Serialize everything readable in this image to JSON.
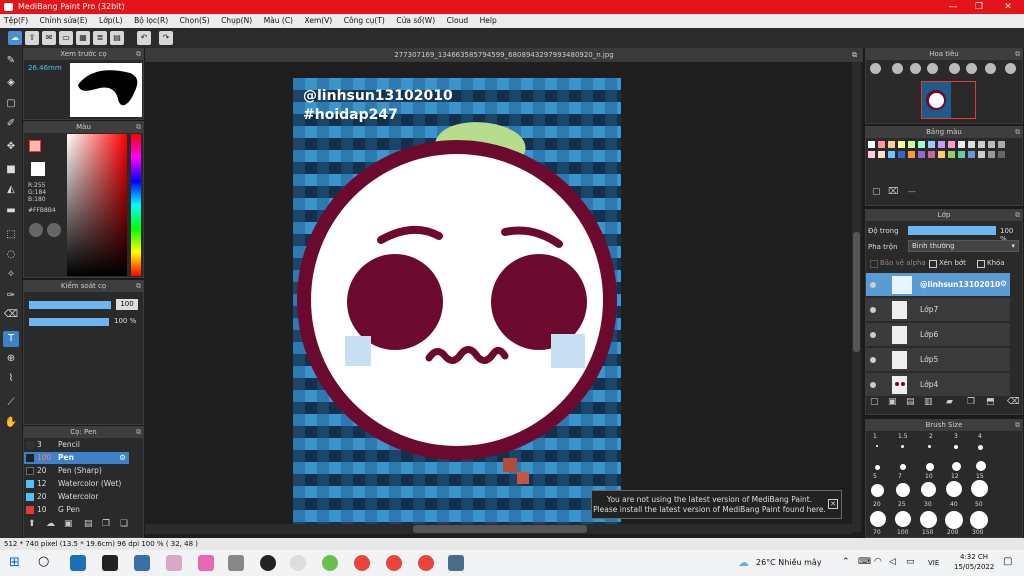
{
  "window": {
    "title": "MediBang Paint Pro (32bit)",
    "controls": [
      "—",
      "❐",
      "✕"
    ]
  },
  "menu": [
    "Tệp(F)",
    "Chỉnh sửa(E)",
    "Lớp(L)",
    "Bộ lọc(R)",
    "Chọn(S)",
    "Chụp(N)",
    "Màu (C)",
    "Xem(V)",
    "Công cụ(T)",
    "Cửa sổ(W)",
    "Cloud",
    "Help"
  ],
  "document": {
    "filename": "277307169_1346635857945​99_6808943297993480920_n.jpg"
  },
  "preview": {
    "title": "Xem trước cọ",
    "size": "26.46mm"
  },
  "color_panel": {
    "title": "Màu",
    "r": "R:255",
    "g": "G:184",
    "b": "B:180",
    "hex": "#FFB8B4",
    "primary": "#ffb8b4",
    "secondary": "#ffffff"
  },
  "brush_control": {
    "title": "Kiểm soát cọ",
    "size": "100",
    "opacity": "100 %"
  },
  "brush_list": {
    "title": "Cọ: Pen",
    "items": [
      {
        "size": "3",
        "name": "Pencil",
        "color": "#333333"
      },
      {
        "size": "100",
        "name": "Pen",
        "color": "#222222"
      },
      {
        "size": "20",
        "name": "Pen (Sharp)",
        "color": "#222222"
      },
      {
        "size": "12",
        "name": "Watercolor (Wet)",
        "color": "#4fc3f7"
      },
      {
        "size": "20",
        "name": "Watercolor",
        "color": "#4fc3f7"
      },
      {
        "size": "10",
        "name": "G Pen",
        "color": "#e53935"
      }
    ]
  },
  "canvas_text": {
    "line1": "@linhsun13102010",
    "line2": "#hoidap247"
  },
  "notice": {
    "line1": "You are not using the latest version of MediBang Paint.",
    "line2": "Please install the latest version of MediBang Paint found here."
  },
  "navigator": {
    "title": "Hoa tiêu"
  },
  "palette": {
    "title": "Bảng màu",
    "footer": "---"
  },
  "layer_panel": {
    "title": "Lớp",
    "opacity_label": "Độ trong",
    "opacity_value": "100 %",
    "blend_label": "Pha trộn",
    "blend_value": "Bình thường",
    "protect_alpha": "Bảo vệ alpha",
    "clipping": "Xén bớt",
    "lock": "Khóa",
    "layers": [
      "@linhsun13102010",
      "Lớp7",
      "Lớp6",
      "Lớp5",
      "Lớp4"
    ]
  },
  "brush_size": {
    "title": "Brush Size",
    "labels": [
      "1",
      "1.5",
      "2",
      "3",
      "4",
      "5",
      "7",
      "10",
      "12",
      "15",
      "20",
      "25",
      "30",
      "40",
      "50",
      "70",
      "100",
      "150",
      "200",
      "300"
    ]
  },
  "status": {
    "text": "512 * 740 pixel   (13.5 * 19.6cm)  96 dpi  100 %  ( 32, 48 )"
  },
  "taskbar": {
    "weather": "26°C  Nhiều mây",
    "lang": "VIE",
    "time": "4:32 CH",
    "date": "15/05/2022"
  },
  "colors": {
    "title_red": "#e4141b",
    "plum": "#6b0a2e",
    "blue_sel": "#3b83c6",
    "leaf": "#b6dd8c"
  }
}
